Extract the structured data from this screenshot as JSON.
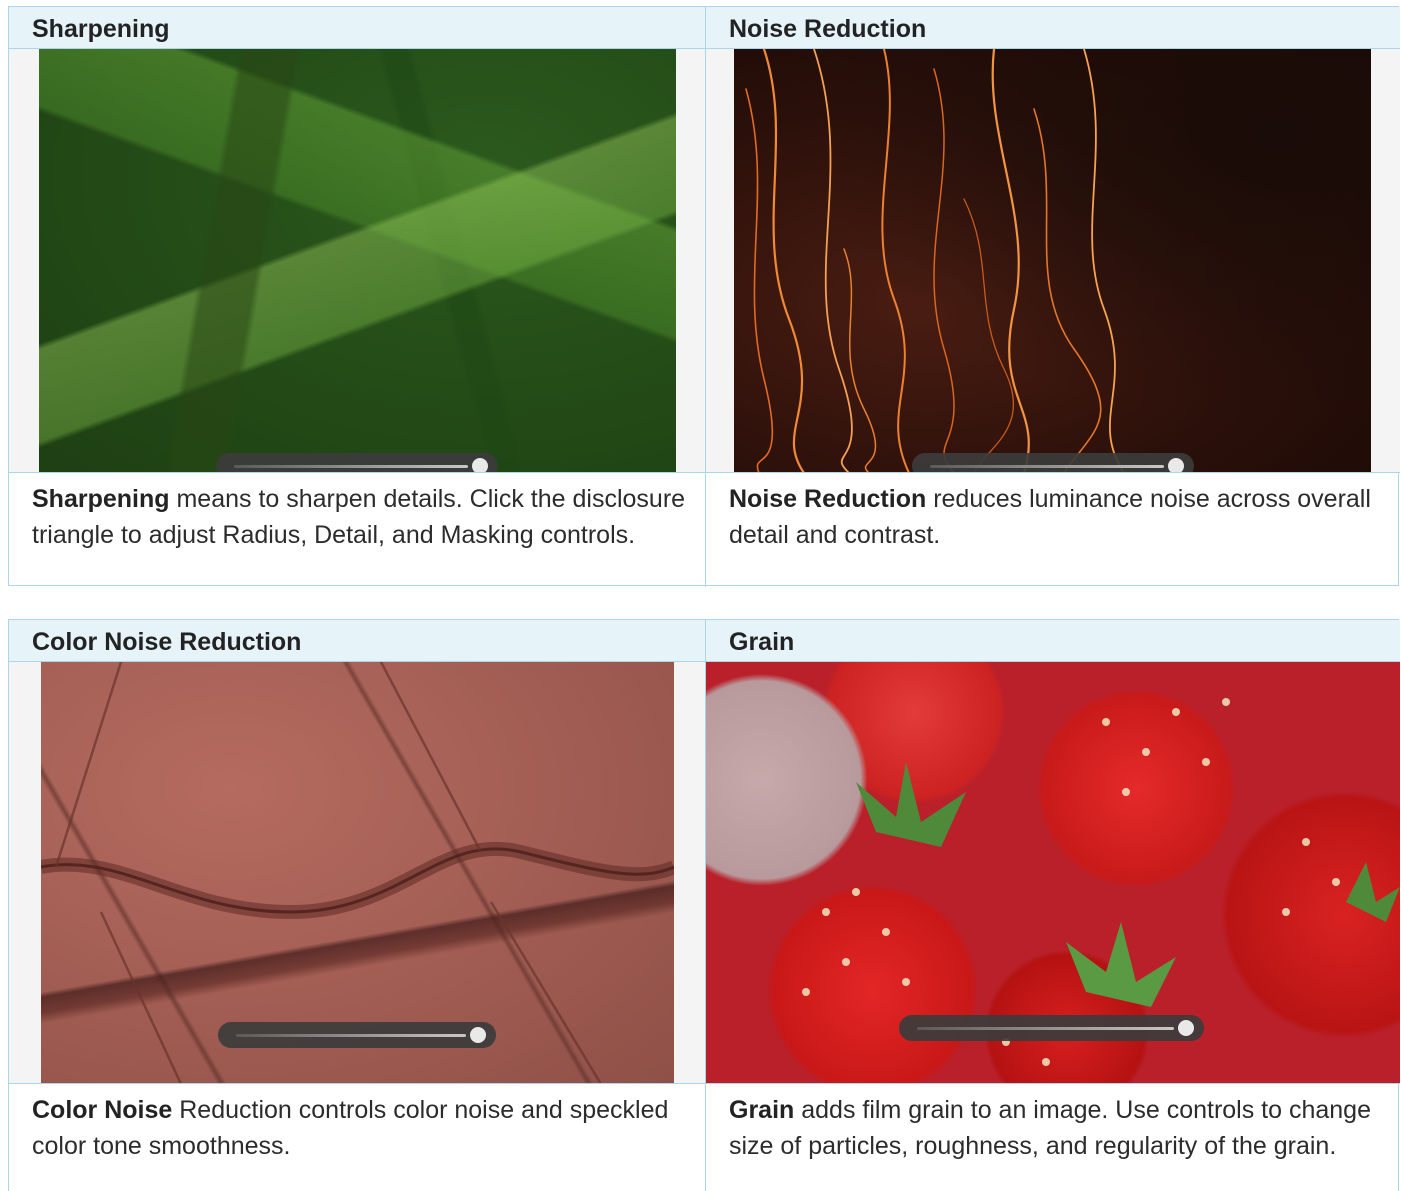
{
  "panels": [
    {
      "title": "Sharpening",
      "desc_bold": "Sharpening",
      "desc_text": " means to sharpen details. Click the disclosure triangle to adjust Radius, Detail, and Masking controls.",
      "slider_value": 1.0
    },
    {
      "title": "Noise Reduction",
      "desc_bold": "Noise Reduction",
      "desc_text": " reduces luminance noise across overall detail and contrast.",
      "slider_value": 1.0
    },
    {
      "title": "Color Noise Reduction",
      "desc_bold": "Color Noise",
      "desc_text": " Reduction controls color noise and speckled color tone smoothness.",
      "slider_value": 1.0
    },
    {
      "title": "Grain",
      "desc_bold": "Grain",
      "desc_text": " adds film grain to an image. Use controls to change size of particles, roughness, and regularity of the grain.",
      "slider_value": 1.0
    }
  ],
  "colors": {
    "header_bg": "#e6f4fa",
    "border": "#a9d6ea",
    "text": "#2c2c2c"
  }
}
